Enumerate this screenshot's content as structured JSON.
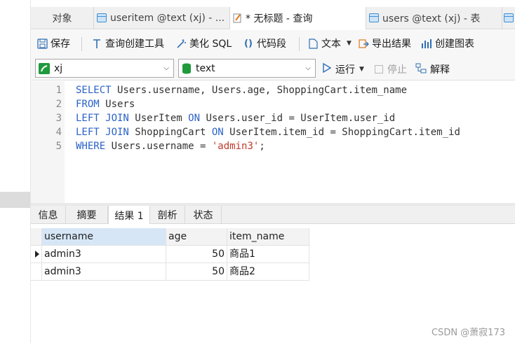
{
  "tabs": [
    {
      "label": "对象",
      "icon": "none",
      "active": false
    },
    {
      "label": "useritem @text (xj) - ...",
      "icon": "table-icon",
      "active": false
    },
    {
      "label": "* 无标题 - 查询",
      "icon": "query-icon",
      "active": true
    },
    {
      "label": "users @text (xj) - 表",
      "icon": "table-icon",
      "active": false
    }
  ],
  "toolbar": {
    "save": "保存",
    "query_builder": "查询创建工具",
    "beautify": "美化 SQL",
    "snippet": "代码段",
    "text": "文本",
    "export": "导出结果",
    "chart": "创建图表"
  },
  "connection": {
    "name": "xj",
    "database": "text",
    "run": "运行",
    "stop": "停止",
    "explain": "解释"
  },
  "editor": {
    "line_numbers": [
      "1",
      "2",
      "3",
      "4",
      "5"
    ],
    "lines": [
      [
        {
          "t": "kw",
          "s": "SELECT"
        },
        {
          "t": "id",
          "s": " Users.username, Users.age, ShoppingCart.item_name"
        }
      ],
      [
        {
          "t": "kw",
          "s": "FROM"
        },
        {
          "t": "id",
          "s": " Users"
        }
      ],
      [
        {
          "t": "kw",
          "s": "LEFT JOIN"
        },
        {
          "t": "id",
          "s": " UserItem "
        },
        {
          "t": "kw",
          "s": "ON"
        },
        {
          "t": "id",
          "s": " Users.user_id = UserItem.user_id"
        }
      ],
      [
        {
          "t": "kw",
          "s": "LEFT JOIN"
        },
        {
          "t": "id",
          "s": " ShoppingCart "
        },
        {
          "t": "kw",
          "s": "ON"
        },
        {
          "t": "id",
          "s": " UserItem.item_id = ShoppingCart.item_id"
        }
      ],
      [
        {
          "t": "kw",
          "s": "WHERE"
        },
        {
          "t": "id",
          "s": " Users.username = "
        },
        {
          "t": "str",
          "s": "'admin3'"
        },
        {
          "t": "id",
          "s": ";"
        }
      ]
    ]
  },
  "result_tabs": [
    "信息",
    "摘要",
    "结果 1",
    "剖析",
    "状态"
  ],
  "result_active": "结果 1",
  "grid": {
    "columns": [
      "username",
      "age",
      "item_name"
    ],
    "rows": [
      [
        "admin3",
        "50",
        "商品1"
      ],
      [
        "admin3",
        "50",
        "商品2"
      ]
    ]
  },
  "watermark": "CSDN @萧寂173",
  "colors": {
    "keyword": "#2b62c9",
    "string": "#c0392b",
    "accent": "#2f6fb3",
    "run_green": "#1f9a3c"
  }
}
